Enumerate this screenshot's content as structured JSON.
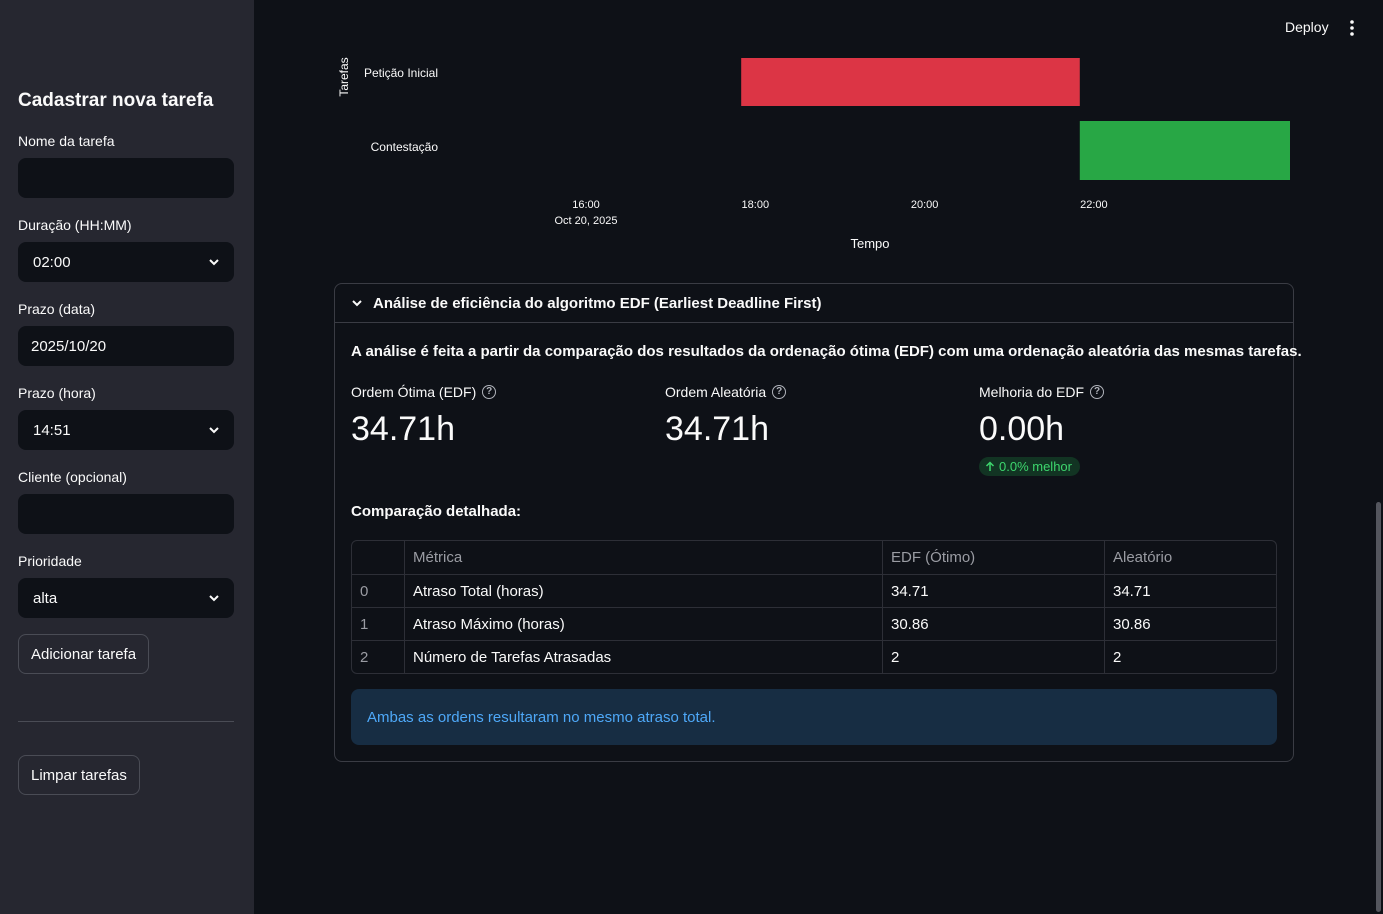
{
  "header": {
    "deploy_label": "Deploy"
  },
  "sidebar": {
    "title": "Cadastrar nova tarefa",
    "fields": {
      "name": {
        "label": "Nome da tarefa",
        "value": ""
      },
      "duration": {
        "label": "Duração (HH:MM)",
        "value": "02:00"
      },
      "deadline_date": {
        "label": "Prazo (data)",
        "value": "2025/10/20"
      },
      "deadline_time": {
        "label": "Prazo (hora)",
        "value": "14:51"
      },
      "client": {
        "label": "Cliente (opcional)",
        "value": ""
      },
      "priority": {
        "label": "Prioridade",
        "value": "alta"
      }
    },
    "add_button": "Adicionar tarefa",
    "clear_button": "Limpar tarefas"
  },
  "chart_data": {
    "type": "gantt",
    "xlabel": "Tempo",
    "ylabel": "Tarefas",
    "x_ticks": [
      "16:00",
      "18:00",
      "20:00",
      "22:00"
    ],
    "x_first_tick_date": "Oct 20, 2025",
    "tasks": [
      {
        "name": "Petição Inicial",
        "start": "17:50",
        "end": "21:50",
        "color": "#dc3545"
      },
      {
        "name": "Contestação",
        "start": "21:50",
        "end": "24:50",
        "color": "#28a745"
      }
    ]
  },
  "expander": {
    "title": "Análise de eficiência do algoritmo EDF (Earliest Deadline First)",
    "intro": "A análise é feita a partir da comparação dos resultados da ordenação ótima (EDF) com uma ordenação aleatória das mesmas tarefas.",
    "metrics": [
      {
        "label": "Ordem Ótima (EDF)",
        "value": "34.71h"
      },
      {
        "label": "Ordem Aleatória",
        "value": "34.71h"
      },
      {
        "label": "Melhoria do EDF",
        "value": "0.00h",
        "delta": "0.0% melhor"
      }
    ],
    "comparison_title": "Comparação detalhada:",
    "table": {
      "columns": [
        "",
        "Métrica",
        "EDF (Ótimo)",
        "Aleatório"
      ],
      "rows": [
        [
          "0",
          "Atraso Total (horas)",
          "34.71",
          "34.71"
        ],
        [
          "1",
          "Atraso Máximo (horas)",
          "30.86",
          "30.86"
        ],
        [
          "2",
          "Número de Tarefas Atrasadas",
          "2",
          "2"
        ]
      ]
    },
    "info": "Ambas as ordens resultaram no mesmo atraso total."
  },
  "colors": {
    "accent_info": "#4ea8f8",
    "delta_positive": "#3dd56d"
  }
}
